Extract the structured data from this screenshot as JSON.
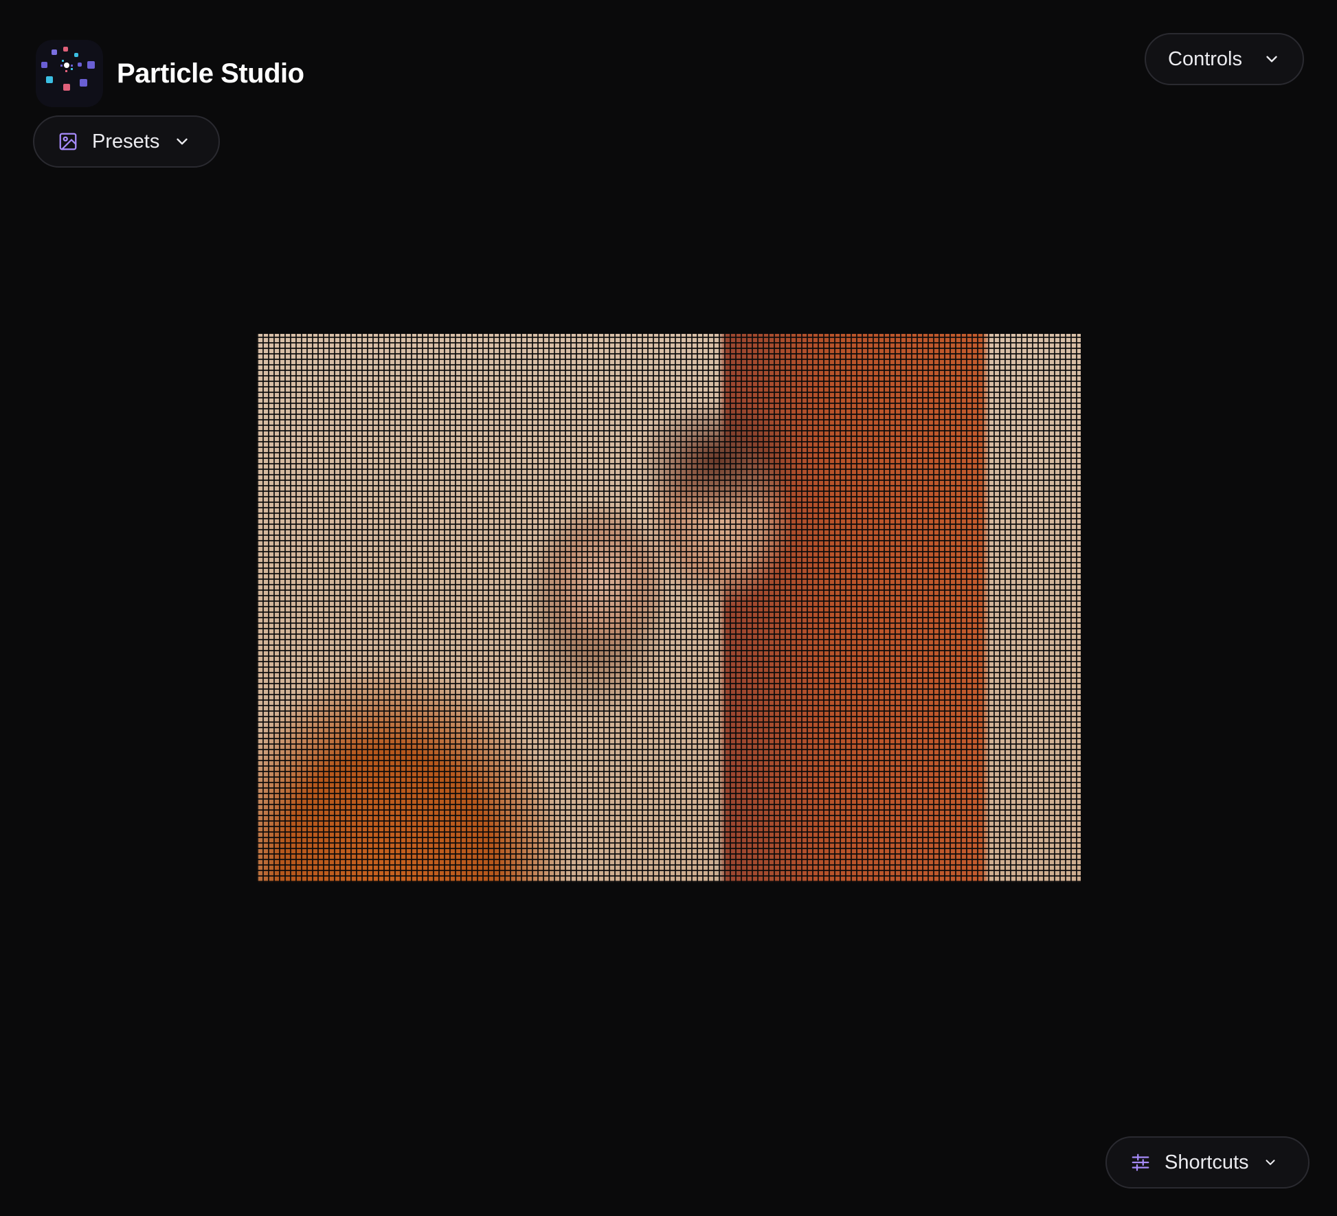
{
  "app": {
    "title": "Particle Studio",
    "logo_icon": "particle-logo-icon"
  },
  "toolbar": {
    "presets_label": "Presets",
    "presets_icon": "image-icon",
    "controls_label": "Controls",
    "shortcuts_label": "Shortcuts",
    "shortcuts_icon": "sliders-icon"
  },
  "canvas": {
    "content": "particle-rendered photo",
    "render_style": "square particle grid"
  },
  "colors": {
    "background": "#0a0a0b",
    "pill_background": "#111114",
    "pill_border": "#2a2a30",
    "accent_purple": "#a78bfa",
    "logo_blue": "#6a5fd4",
    "logo_cyan": "#3bbfe3",
    "logo_pink": "#e0607a"
  }
}
